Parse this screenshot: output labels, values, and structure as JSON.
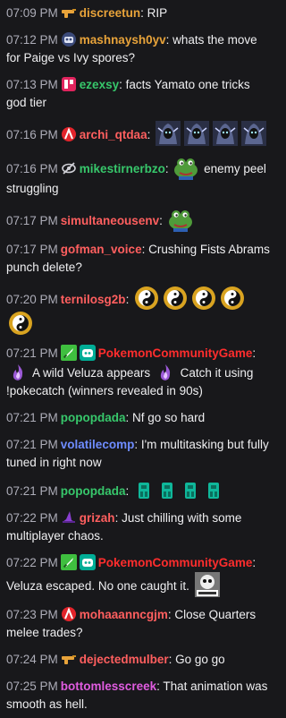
{
  "messages": [
    {
      "time": "07:09 PM",
      "badges": [
        "gun-badge"
      ],
      "user": "discreetun",
      "color": "#e8a33a",
      "parts": [
        {
          "t": "text",
          "v": ": RIP"
        }
      ]
    },
    {
      "time": "07:12 PM",
      "badges": [
        "robot-badge"
      ],
      "user": "mashnaysh0yv",
      "color": "#e8a33a",
      "parts": [
        {
          "t": "text",
          "v": ": whats the move for Paige vs Ivy spores?"
        }
      ]
    },
    {
      "time": "07:13 PM",
      "badges": [
        "red-square-badge"
      ],
      "user": "ezexsy",
      "color": "#37c76b",
      "parts": [
        {
          "t": "text",
          "v": ": facts Yamato one tricks god tier"
        }
      ]
    },
    {
      "time": "07:16 PM",
      "badges": [
        "a-badge"
      ],
      "user": "archi_qtdaa",
      "color": "#ff5f5f",
      "parts": [
        {
          "t": "text",
          "v": ": "
        },
        {
          "t": "emote",
          "v": "hooded-figure-emote"
        },
        {
          "t": "emote",
          "v": "hooded-figure-emote"
        },
        {
          "t": "emote",
          "v": "hooded-figure-emote"
        },
        {
          "t": "emote",
          "v": "hooded-figure-emote"
        }
      ]
    },
    {
      "time": "07:16 PM",
      "badges": [
        "no-eye-badge"
      ],
      "user": "mikestirnerbzo",
      "color": "#37c76b",
      "parts": [
        {
          "t": "text",
          "v": ": "
        },
        {
          "t": "emote",
          "v": "frog-emote"
        },
        {
          "t": "text",
          "v": " enemy peel struggling"
        }
      ]
    },
    {
      "time": "07:17 PM",
      "badges": [],
      "user": "simultaneousenv",
      "color": "#ff5f5f",
      "parts": [
        {
          "t": "text",
          "v": ": "
        },
        {
          "t": "emote",
          "v": "frog-emote"
        }
      ]
    },
    {
      "time": "07:17 PM",
      "badges": [],
      "user": "gofman_voice",
      "color": "#ff5f5f",
      "parts": [
        {
          "t": "text",
          "v": ": Crushing Fists Abrams punch delete?"
        }
      ]
    },
    {
      "time": "07:20 PM",
      "badges": [],
      "user": "ternilosg2b",
      "color": "#ff5f5f",
      "parts": [
        {
          "t": "text",
          "v": ": "
        },
        {
          "t": "emote",
          "v": "yin-yang-emote"
        },
        {
          "t": "emote",
          "v": "yin-yang-emote"
        },
        {
          "t": "emote",
          "v": "yin-yang-emote"
        },
        {
          "t": "emote",
          "v": "yin-yang-emote"
        },
        {
          "t": "emote",
          "v": "yin-yang-emote"
        }
      ]
    },
    {
      "time": "07:21 PM",
      "badges": [
        "sword-badge",
        "bot-badge"
      ],
      "user": "PokemonCommunityGame",
      "color": "#ff2d2d",
      "parts": [
        {
          "t": "text",
          "v": ": "
        },
        {
          "t": "emote",
          "v": "purple-flame-emote"
        },
        {
          "t": "text",
          "v": " A wild Veluza appears "
        },
        {
          "t": "emote",
          "v": "purple-flame-emote"
        },
        {
          "t": "text",
          "v": " Catch it using !pokecatch (winners revealed in 90s)"
        }
      ]
    },
    {
      "time": "07:21 PM",
      "badges": [],
      "user": "popopdada",
      "color": "#37c76b",
      "parts": [
        {
          "t": "text",
          "v": ": Nf go so hard"
        }
      ]
    },
    {
      "time": "07:21 PM",
      "badges": [],
      "user": "volatilecomp",
      "color": "#6e8cff",
      "parts": [
        {
          "t": "text",
          "v": ": I'm multitasking but fully tuned in right now"
        }
      ]
    },
    {
      "time": "07:21 PM",
      "badges": [],
      "user": "popopdada",
      "color": "#37c76b",
      "parts": [
        {
          "t": "text",
          "v": ": "
        },
        {
          "t": "emote",
          "v": "teal-figure-emote"
        },
        {
          "t": "emote",
          "v": "teal-figure-emote"
        },
        {
          "t": "emote",
          "v": "teal-figure-emote"
        },
        {
          "t": "emote",
          "v": "teal-figure-emote"
        }
      ]
    },
    {
      "time": "07:22 PM",
      "badges": [
        "witch-hat-badge"
      ],
      "user": "grizah",
      "color": "#ff5f5f",
      "parts": [
        {
          "t": "text",
          "v": ": Just chilling with some multiplayer chaos."
        }
      ]
    },
    {
      "time": "07:22 PM",
      "badges": [
        "sword-badge",
        "bot-badge"
      ],
      "user": "PokemonCommunityGame",
      "color": "#ff2d2d",
      "parts": [
        {
          "t": "text",
          "v": ": Veluza escaped. No one caught it. "
        },
        {
          "t": "emote",
          "v": "rigged-emote"
        }
      ]
    },
    {
      "time": "07:23 PM",
      "badges": [
        "a-badge"
      ],
      "user": "mohaaanncgjm",
      "color": "#ff5f5f",
      "parts": [
        {
          "t": "text",
          "v": ": Close Quarters melee trades?"
        }
      ]
    },
    {
      "time": "07:24 PM",
      "badges": [
        "gun-badge"
      ],
      "user": "dejectedmulber",
      "color": "#ff5f5f",
      "parts": [
        {
          "t": "text",
          "v": ": Go go go"
        }
      ]
    },
    {
      "time": "07:25 PM",
      "badges": [],
      "user": "bottomlesscreek",
      "color": "#e05ce0",
      "parts": [
        {
          "t": "text",
          "v": ": That animation was smooth as hell."
        }
      ]
    }
  ]
}
